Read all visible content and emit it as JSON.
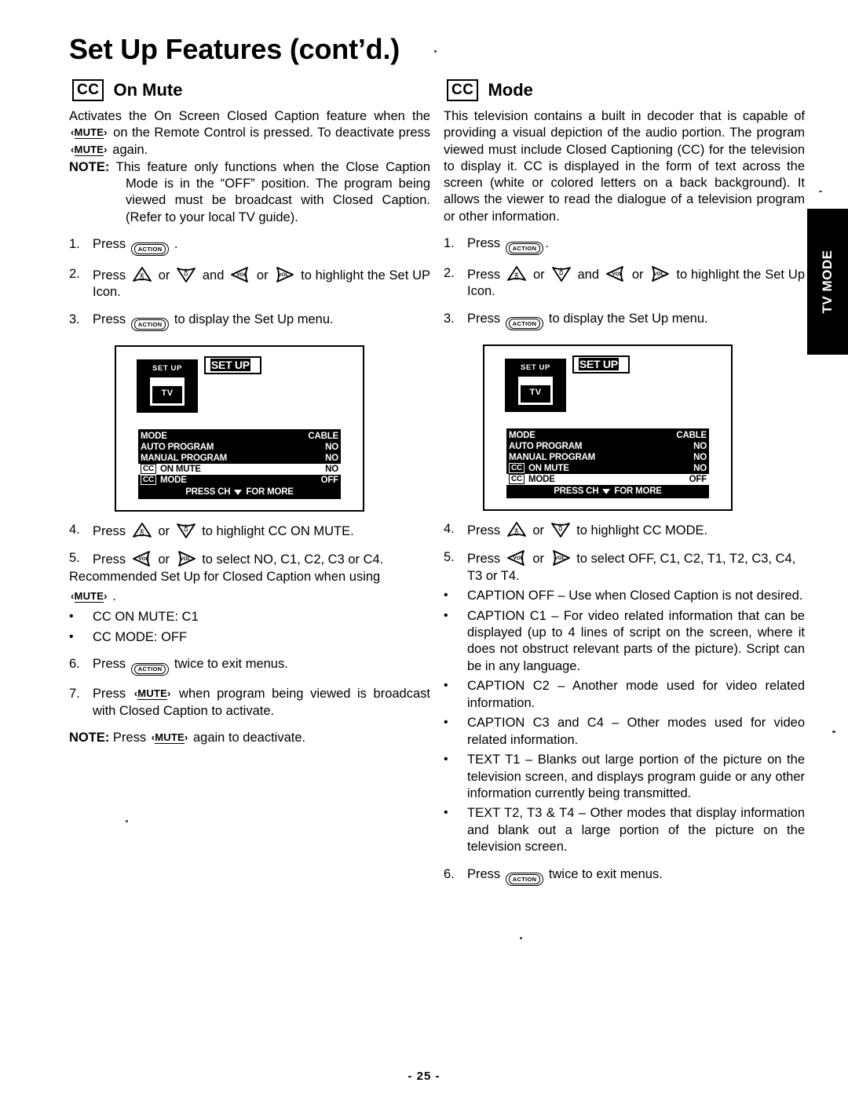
{
  "page": {
    "title": "Set Up Features (cont’d.)",
    "footer": "- 25 -",
    "edge_tab": "TV MODE"
  },
  "keys": {
    "action": "ACTION",
    "mute": "MUTE",
    "ch_up": "CH",
    "ch_down": "CH",
    "vol_down": "VOL",
    "vol_up": "VOL"
  },
  "left": {
    "cc_badge": "CC",
    "heading": "On Mute",
    "intro_1": "Activates the On Screen Closed Caption feature when the ",
    "intro_2": " on the Remote Control is pressed. To deactivate press ",
    "intro_3": " again.",
    "note_label": "NOTE:",
    "note_text": " This feature only functions when the Close Caption Mode is in the “OFF” position. The program being viewed must be broadcast with Closed Caption. (Refer to your local TV guide).",
    "steps": [
      {
        "num": "1.",
        "pre": "Press ",
        "post": " ."
      },
      {
        "num": "2.",
        "pre": "Press ",
        "mid1": " or ",
        "mid2": " and ",
        "mid3": " or ",
        "post": " to highlight the Set UP Icon."
      },
      {
        "num": "3.",
        "pre": "Press ",
        "post": " to display the Set Up menu."
      },
      {
        "num": "4.",
        "pre": "Press ",
        "mid1": " or ",
        "post": " to highlight CC ON MUTE."
      },
      {
        "num": "5.",
        "pre": "Press ",
        "mid1": " or ",
        "post": " to select NO, C1, C2, C3 or C4."
      }
    ],
    "recommend_line": "Recommended Set Up for Closed Caption when using ",
    "recommend_tail": " .",
    "bullets": [
      "CC ON MUTE: C1",
      "CC MODE: OFF"
    ],
    "step6": {
      "num": "6.",
      "pre": "Press ",
      "post": " twice to exit menus."
    },
    "step7": {
      "num": "7.",
      "pre": "Press ",
      "post": " when program being viewed is broadcast with Closed Caption  to activate."
    },
    "final_note_label": "NOTE:",
    "final_note_pre": " Press ",
    "final_note_post": " again to deactivate."
  },
  "right": {
    "cc_badge": "CC",
    "heading": "Mode",
    "intro": "This television contains a  built in decoder that is capable of providing a visual depiction  of the audio portion. The program viewed  must include Closed Captioning (CC) for the television to display it. CC is displayed in the form of text across the screen (white or colored letters on a back background). It allows the viewer to read the dialogue of a television program or other information.",
    "steps": [
      {
        "num": "1.",
        "pre": "Press ",
        "post": "."
      },
      {
        "num": "2.",
        "pre": "Press ",
        "mid1": " or ",
        "mid2": " and ",
        "mid3": " or ",
        "post": " to highlight the Set Up Icon."
      },
      {
        "num": "3.",
        "pre": "Press ",
        "post": " to display the Set Up menu."
      },
      {
        "num": "4.",
        "pre": "Press ",
        "mid1": " or ",
        "post": " to highlight CC MODE."
      },
      {
        "num": "5.",
        "pre": "Press ",
        "mid1": " or ",
        "post": " to select OFF, C1, C2, T1, T2, C3, C4, T3 or T4."
      }
    ],
    "bullets": [
      "CAPTION OFF – Use when Closed Caption is not desired.",
      "CAPTION C1 – For video related  information that can be displayed (up to 4 lines of script on the screen, where it does not obstruct relevant parts of the picture). Script can be in any language.",
      "CAPTION C2 – Another mode used  for video related information.",
      "CAPTION C3 and C4 – Other modes used for video related information.",
      "TEXT T1 – Blanks out large portion of the picture on the television screen, and displays program guide or any other information currently being transmitted.",
      "TEXT  T2, T3 & T4 – Other modes that display information and blank out a large portion of the picture on the television screen."
    ],
    "step6": {
      "num": "6.",
      "pre": "Press ",
      "post": " twice to exit menus."
    }
  },
  "tv_menu_left": {
    "setup_icon_label": "SET UP",
    "setup_icon_tv": "TV",
    "setup_title": "SET UP",
    "rows": [
      {
        "cc": false,
        "label": "MODE",
        "value": "CABLE",
        "highlight": false
      },
      {
        "cc": false,
        "label": "AUTO PROGRAM",
        "value": "NO",
        "highlight": false
      },
      {
        "cc": false,
        "label": "MANUAL PROGRAM",
        "value": "NO",
        "highlight": false
      },
      {
        "cc": true,
        "cc_text": "CC",
        "label": "ON MUTE",
        "value": "NO",
        "highlight": true
      },
      {
        "cc": true,
        "cc_text": "CC",
        "label": "MODE",
        "value": "OFF",
        "highlight": false
      }
    ],
    "footer_pre": "PRESS CH",
    "footer_post": "FOR MORE"
  },
  "tv_menu_right": {
    "setup_icon_label": "SET UP",
    "setup_icon_tv": "TV",
    "setup_title": "SET UP",
    "rows": [
      {
        "cc": false,
        "label": "MODE",
        "value": "CABLE",
        "highlight": false
      },
      {
        "cc": false,
        "label": "AUTO PROGRAM",
        "value": "NO",
        "highlight": false
      },
      {
        "cc": false,
        "label": "MANUAL PROGRAM",
        "value": "NO",
        "highlight": false
      },
      {
        "cc": true,
        "cc_text": "CC",
        "label": "ON MUTE",
        "value": "NO",
        "highlight": false
      },
      {
        "cc": true,
        "cc_text": "CC",
        "label": "MODE",
        "value": "OFF",
        "highlight": true
      }
    ],
    "footer_pre": "PRESS CH",
    "footer_post": "FOR MORE"
  }
}
